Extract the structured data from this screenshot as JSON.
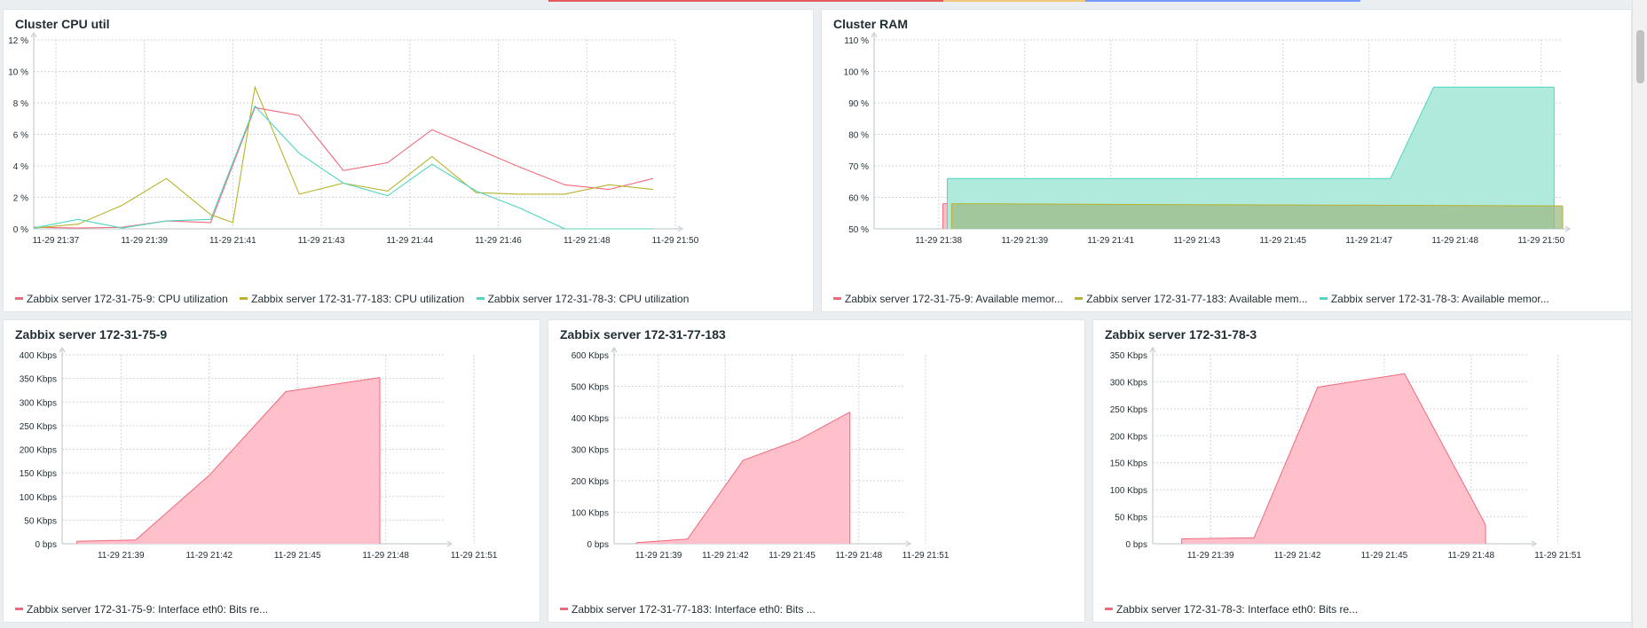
{
  "colors": {
    "red": "#f0697b",
    "olive": "#b8b32c",
    "teal": "#4fd6c0",
    "red_fill": "#ffc0cb",
    "teal_fill": "#afeadd",
    "olive_fill": "#9fbb87",
    "grid": "#cfd6d9",
    "axis_text": "#1f2c33"
  },
  "widgets": [
    {
      "title": "Cluster CPU util",
      "legend": [
        {
          "label": "Zabbix server 172-31-75-9: CPU utilization",
          "color": "#f0697b"
        },
        {
          "label": "Zabbix server 172-31-77-183: CPU utilization",
          "color": "#b8b32c"
        },
        {
          "label": "Zabbix server 172-31-78-3: CPU utilization",
          "color": "#4fd6c0"
        }
      ]
    },
    {
      "title": "Cluster RAM",
      "legend": [
        {
          "label": "Zabbix server 172-31-75-9: Available memor...",
          "color": "#f0697b"
        },
        {
          "label": "Zabbix server 172-31-77-183: Available mem...",
          "color": "#b8b32c"
        },
        {
          "label": "Zabbix server 172-31-78-3: Available memor...",
          "color": "#4fd6c0"
        }
      ]
    },
    {
      "title": "Zabbix server 172-31-75-9",
      "legend": [
        {
          "label": "Zabbix server 172-31-75-9: Interface eth0: Bits re...",
          "color": "#f0697b"
        }
      ]
    },
    {
      "title": "Zabbix server 172-31-77-183",
      "legend": [
        {
          "label": "Zabbix server 172-31-77-183: Interface eth0: Bits ...",
          "color": "#f0697b"
        }
      ]
    },
    {
      "title": "Zabbix server 172-31-78-3",
      "legend": [
        {
          "label": "Zabbix server 172-31-78-3: Interface eth0: Bits re...",
          "color": "#f0697b"
        }
      ]
    }
  ],
  "chart_data": [
    {
      "type": "line",
      "title": "Cluster CPU util",
      "y_ticks": [
        "0 %",
        "2 %",
        "4 %",
        "6 %",
        "8 %",
        "10 %",
        "12 %"
      ],
      "ylim": [
        0,
        12
      ],
      "x_ticks": [
        "11-29 21:37",
        "11-29 21:39",
        "11-29 21:41",
        "11-29 21:43",
        "11-29 21:44",
        "11-29 21:46",
        "11-29 21:48",
        "11-29 21:50"
      ],
      "xlim": [
        0,
        14.5
      ],
      "x_tick_values": [
        0.5,
        2.5,
        4.5,
        6.5,
        8.5,
        10.5,
        12.5,
        14.5
      ],
      "grid": true,
      "series": [
        {
          "name": "Zabbix server 172-31-75-9: CPU utilization",
          "color": "#f0697b",
          "x": [
            0,
            1,
            2,
            3,
            4,
            5,
            6,
            7,
            8,
            9,
            10,
            11,
            12,
            13,
            14
          ],
          "y": [
            0.1,
            0.05,
            0.1,
            0.5,
            0.4,
            7.7,
            7.2,
            3.7,
            4.2,
            6.3,
            5.1,
            3.9,
            2.8,
            2.5,
            3.2
          ]
        },
        {
          "name": "Zabbix server 172-31-77-183: CPU utilization",
          "color": "#b8b32c",
          "x": [
            0,
            1,
            2,
            3,
            4,
            4.5,
            5,
            6,
            7,
            8,
            9,
            10,
            11,
            12,
            13,
            14
          ],
          "y": [
            0.05,
            0.3,
            1.5,
            3.2,
            0.9,
            0.4,
            9.0,
            2.2,
            2.9,
            2.4,
            4.6,
            2.3,
            2.2,
            2.2,
            2.8,
            2.5
          ]
        },
        {
          "name": "Zabbix server 172-31-78-3: CPU utilization",
          "color": "#4fd6c0",
          "x": [
            0,
            1,
            2,
            3,
            4,
            5,
            6,
            7,
            8,
            9,
            10,
            11,
            12,
            13,
            14
          ],
          "y": [
            0.05,
            0.6,
            0.05,
            0.5,
            0.6,
            7.8,
            4.8,
            2.9,
            2.1,
            4.1,
            2.4,
            1.3,
            0.0,
            0.0,
            0.0
          ]
        }
      ]
    },
    {
      "type": "area",
      "title": "Cluster RAM",
      "y_ticks": [
        "50 %",
        "60 %",
        "70 %",
        "80 %",
        "90 %",
        "100 %",
        "110 %"
      ],
      "ylim": [
        50,
        110
      ],
      "x_ticks": [
        "11-29 21:38",
        "11-29 21:39",
        "11-29 21:41",
        "11-29 21:43",
        "11-29 21:45",
        "11-29 21:47",
        "11-29 21:48",
        "11-29 21:50"
      ],
      "xlim": [
        0,
        16
      ],
      "x_tick_values": [
        1.5,
        3.5,
        5.5,
        7.5,
        9.5,
        11.5,
        13.5,
        15.5
      ],
      "grid": true,
      "series": [
        {
          "name": "Zabbix server 172-31-75-9: Available memor...",
          "color": "#f0697b",
          "x": [
            1.6,
            15.8
          ],
          "y": [
            58.0,
            57.5
          ]
        },
        {
          "name": "Zabbix server 172-31-78-3: Available memor...",
          "color": "#4fd6c0",
          "x": [
            1.7,
            12.0,
            13.0,
            15.8
          ],
          "y": [
            66.0,
            66.0,
            95.0,
            95.0
          ]
        },
        {
          "name": "Zabbix server 172-31-77-183: Available mem...",
          "color": "#b8b32c",
          "x": [
            1.8,
            5.0,
            15.9,
            16.0
          ],
          "y": [
            58.0,
            57.8,
            57.3,
            57.3
          ]
        }
      ]
    },
    {
      "type": "area",
      "title": "Zabbix server 172-31-75-9",
      "y_ticks": [
        "0 bps",
        "50 Kbps",
        "100 Kbps",
        "150 Kbps",
        "200 Kbps",
        "250 Kbps",
        "300 Kbps",
        "350 Kbps",
        "400 Kbps"
      ],
      "ylim": [
        0,
        400
      ],
      "x_ticks": [
        "11-29 21:39",
        "11-29 21:42",
        "11-29 21:45",
        "11-29 21:48",
        "11-29 21:51"
      ],
      "xlim": [
        0,
        13
      ],
      "x_tick_values": [
        2,
        5,
        8,
        11,
        14
      ],
      "grid": true,
      "series": [
        {
          "name": "Zabbix server 172-31-75-9: Interface eth0: Bits re...",
          "color": "#f0697b",
          "x": [
            0.5,
            2.5,
            5.0,
            7.6,
            10.8
          ],
          "y": [
            5,
            8,
            145,
            322,
            352
          ]
        }
      ]
    },
    {
      "type": "area",
      "title": "Zabbix server 172-31-77-183",
      "y_ticks": [
        "0 bps",
        "100 Kbps",
        "200 Kbps",
        "300 Kbps",
        "400 Kbps",
        "500 Kbps",
        "600 Kbps"
      ],
      "ylim": [
        0,
        600
      ],
      "x_ticks": [
        "11-29 21:39",
        "11-29 21:42",
        "11-29 21:45",
        "11-29 21:48",
        "11-29 21:51"
      ],
      "xlim": [
        0,
        13
      ],
      "x_tick_values": [
        2,
        5,
        8,
        11,
        14
      ],
      "grid": true,
      "series": [
        {
          "name": "Zabbix server 172-31-77-183: Interface eth0: Bits ...",
          "color": "#f0697b",
          "x": [
            1.0,
            3.3,
            5.8,
            8.3,
            10.6
          ],
          "y": [
            3,
            15,
            265,
            330,
            418
          ]
        }
      ]
    },
    {
      "type": "area",
      "title": "Zabbix server 172-31-78-3",
      "y_ticks": [
        "0 bps",
        "50 Kbps",
        "100 Kbps",
        "150 Kbps",
        "200 Kbps",
        "250 Kbps",
        "300 Kbps",
        "350 Kbps"
      ],
      "ylim": [
        0,
        350
      ],
      "x_ticks": [
        "11-29 21:39",
        "11-29 21:42",
        "11-29 21:45",
        "11-29 21:48",
        "11-29 21:51"
      ],
      "xlim": [
        0,
        13
      ],
      "x_tick_values": [
        2,
        5,
        8,
        11,
        14
      ],
      "grid": true,
      "series": [
        {
          "name": "Zabbix server 172-31-78-3: Interface eth0: Bits re...",
          "color": "#f0697b",
          "x": [
            1.0,
            3.5,
            5.7,
            8.7,
            11.5
          ],
          "y": [
            9,
            11,
            290,
            315,
            35
          ]
        }
      ]
    }
  ]
}
